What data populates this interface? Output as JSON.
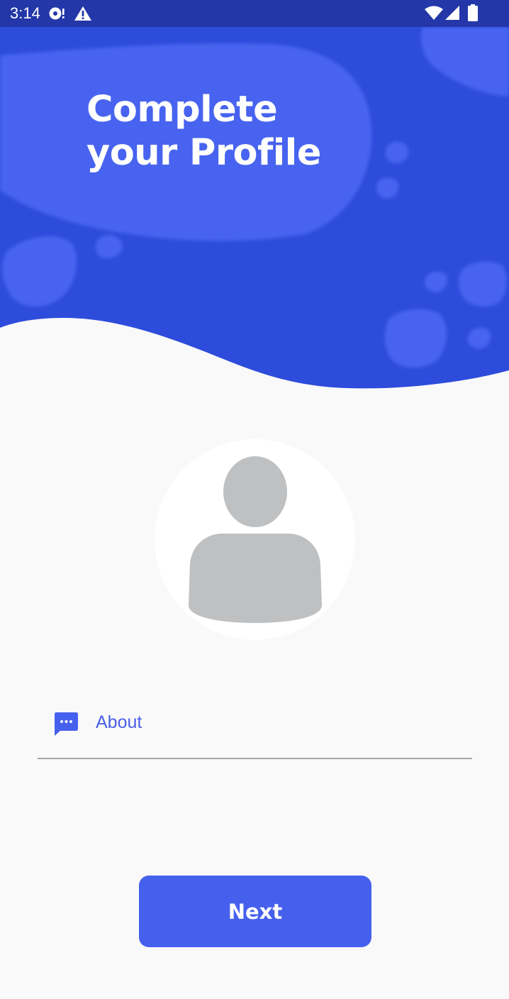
{
  "status_bar": {
    "time": "3:14",
    "icons": [
      "cast-icon",
      "alert-icon",
      "wifi-icon",
      "cellular-signal-icon",
      "battery-icon"
    ]
  },
  "header": {
    "title_line1": "Complete",
    "title_line2": "your Profile"
  },
  "profile": {
    "avatar_icon": "person-icon"
  },
  "form": {
    "about": {
      "icon": "chat-bubble-icon",
      "placeholder": "About",
      "value": ""
    }
  },
  "actions": {
    "next_label": "Next"
  },
  "colors": {
    "status_bar": "#2337a8",
    "header_dark": "#2d4cdb",
    "header_light": "#4664ef",
    "accent": "#4660ee",
    "background": "#f9f9fa",
    "avatar_glyph": "#bfc0c2"
  }
}
